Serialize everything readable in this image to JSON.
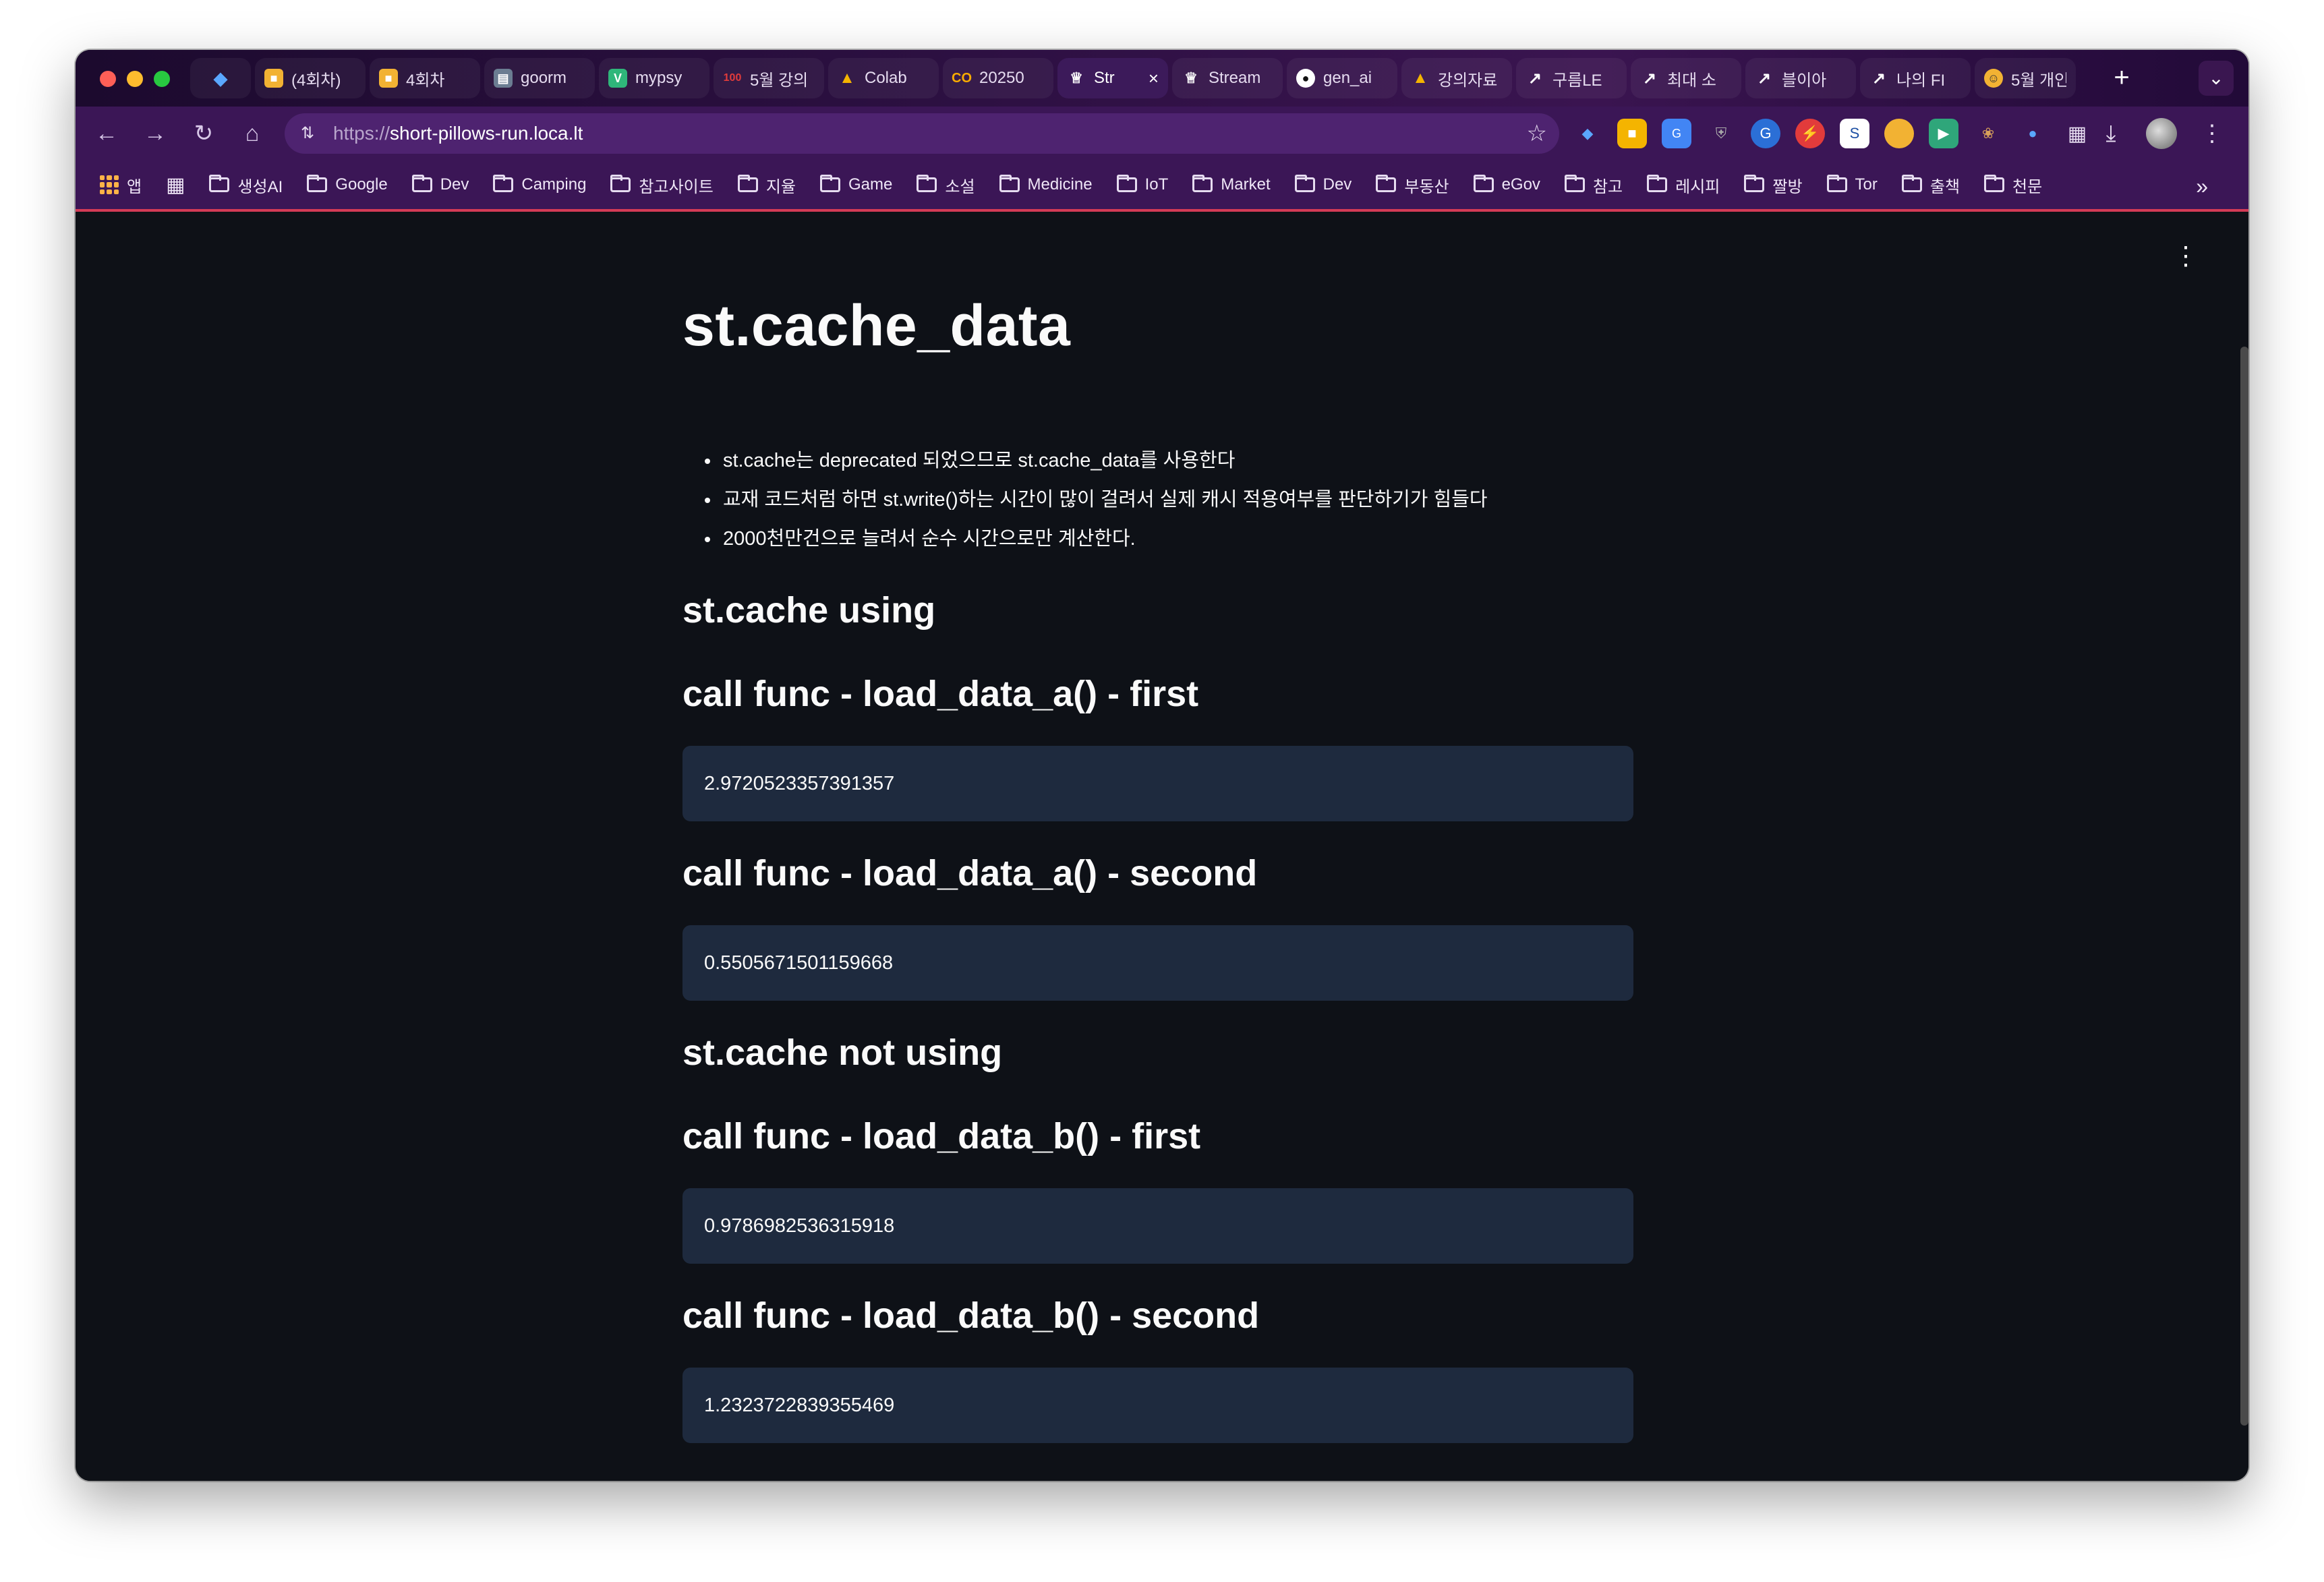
{
  "browser": {
    "tabs": [
      {
        "title": "",
        "icon": "gem-icon",
        "color": "#3a8dde"
      },
      {
        "title": "(4회차)",
        "icon": "box-icon",
        "color": "#f2b233"
      },
      {
        "title": "4회차",
        "icon": "box-icon",
        "color": "#f2b233"
      },
      {
        "title": "goorm",
        "icon": "terminal-icon",
        "color": "#8aa0b8"
      },
      {
        "title": "mypsy",
        "icon": "v-icon",
        "color": "#2fb67a"
      },
      {
        "title": "5월 강의",
        "icon": "hundred-icon",
        "color": "#e23b3b"
      },
      {
        "title": "Colab",
        "icon": "drive-icon",
        "color": "#f4b400"
      },
      {
        "title": "20250",
        "icon": "colab-icon",
        "color": "#f9ab00"
      },
      {
        "title": "Str",
        "icon": "crown-icon",
        "color": "#ffffff",
        "active": true
      },
      {
        "title": "Stream",
        "icon": "crown-icon",
        "color": "#ffffff"
      },
      {
        "title": "gen_ai",
        "icon": "github-icon",
        "color": "#ffffff"
      },
      {
        "title": "강의자료",
        "icon": "drive-icon",
        "color": "#f4b400"
      },
      {
        "title": "구름LE",
        "icon": "arrow-icon",
        "color": "#ffffff"
      },
      {
        "title": "최대 소",
        "icon": "arrow-icon",
        "color": "#ffffff"
      },
      {
        "title": "블이아",
        "icon": "arrow-icon",
        "color": "#ffffff"
      },
      {
        "title": "나의 FI",
        "icon": "arrow-icon",
        "color": "#ffffff"
      },
      {
        "title": "5월 개인",
        "icon": "emoji-icon",
        "color": "#f2b233"
      }
    ],
    "url_proto": "https://",
    "url_host": "short-pillows-run.loca.lt",
    "bookmarks": [
      {
        "label": "생성AI"
      },
      {
        "label": "Google"
      },
      {
        "label": "Dev"
      },
      {
        "label": "Camping"
      },
      {
        "label": "참고사이트"
      },
      {
        "label": "지율"
      },
      {
        "label": "Game"
      },
      {
        "label": "소설"
      },
      {
        "label": "Medicine"
      },
      {
        "label": "IoT"
      },
      {
        "label": "Market"
      },
      {
        "label": "Dev"
      },
      {
        "label": "부동산"
      },
      {
        "label": "eGov"
      },
      {
        "label": "참고"
      },
      {
        "label": "레시피"
      },
      {
        "label": "짤방"
      },
      {
        "label": "Tor"
      },
      {
        "label": "출책"
      },
      {
        "label": "천문"
      }
    ],
    "apps_label": "앱"
  },
  "page": {
    "title": "st.cache_data",
    "bullets": [
      "st.cache는 deprecated 되었으므로 st.cache_data를 사용한다",
      "교재 코드처럼 하면 st.write()하는 시간이 많이 걸려서 실제 캐시 적용여부를 판단하기가 힘들다",
      "2000천만건으로 늘려서 순수 시간으로만 계산한다."
    ],
    "section_using": "st.cache using",
    "a_first_heading": "call func - load_data_a() - first",
    "a_first_value": "2.9720523357391357",
    "a_second_heading": "call func - load_data_a() - second",
    "a_second_value": "0.5505671501159668",
    "section_not_using": "st.cache not using",
    "b_first_heading": "call func - load_data_b() - first",
    "b_first_value": "0.9786982536315918",
    "b_second_heading": "call func - load_data_b() - second",
    "b_second_value": "1.2323722839355469"
  }
}
